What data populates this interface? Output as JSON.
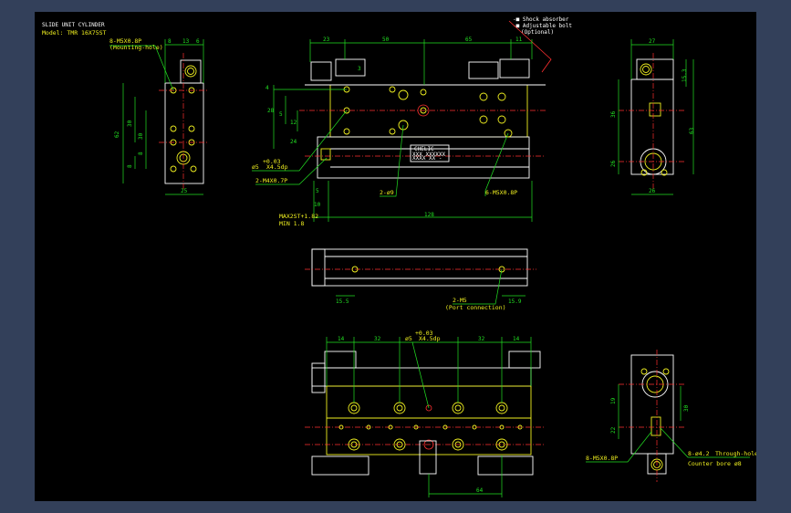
{
  "title_block": {
    "title": "SLIDE UNIT CYLINDER",
    "model": "Model: TMR 16X75ST"
  },
  "legend": {
    "item1": "-■ Shock absorber",
    "item2": "-■ Adjustable bolt",
    "item3": "(Optional)"
  },
  "left_view": {
    "callout": "8-M5X0.8P",
    "callout_sub": "(Mounting-hole)",
    "top_dims": [
      "8",
      "13",
      "6"
    ],
    "side_dims": [
      "62",
      "30",
      "30",
      "8",
      "8"
    ],
    "bottom_dim": "25"
  },
  "front_view": {
    "top_dims": [
      "23",
      "50",
      "65",
      "11"
    ],
    "mid_dim": "3",
    "left_dims": [
      "4",
      "28",
      "5",
      "12",
      "24"
    ],
    "label_phi5": "ø5",
    "label_phi5_sup": "+0.03",
    "label_phi5_depth": "X4.5dp",
    "label_2m4": "2-M4X0.7P",
    "label_2phi9": "2-ø9",
    "label_6m5": "6-M5X0.8P",
    "bottom_dims": [
      "5",
      "10"
    ],
    "max_st": "MAX2ST+1.82",
    "min": "MIN    1.8",
    "length": "128",
    "brand": "CHELIC",
    "plate_line1": "XXX  XXXXXX",
    "plate_line2": "XXXX XX -"
  },
  "right_view": {
    "top_dim": "27",
    "right_dims": [
      "15.3",
      "63"
    ],
    "left_dims": [
      "36",
      "26"
    ],
    "bottom_dim": "26"
  },
  "middle_view": {
    "dim_left": "15.5",
    "dim_right": "15.9",
    "port_label": "2-M5",
    "port_sub": "(Port connection)"
  },
  "bottom_view": {
    "top_dims": [
      "14",
      "32",
      "32",
      "14"
    ],
    "label_phi5": "ø5",
    "label_phi5_sup": "+0.03",
    "label_phi5_depth": "X4.5dp",
    "bottom_dim": "64"
  },
  "bottom_right_view": {
    "left_dims": [
      "19",
      "22"
    ],
    "right_dim": "30",
    "label_8m5": "8-M5X0.8P",
    "label_hole": "8-ø4.2",
    "label_hole_sub": "Through-hole",
    "label_cbore": "Counter bore ø8"
  }
}
